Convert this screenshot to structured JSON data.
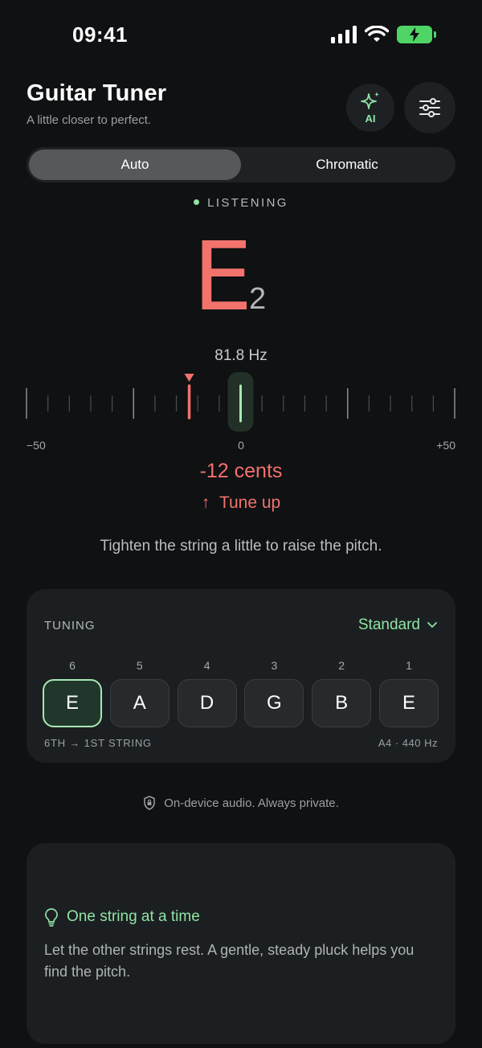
{
  "status_bar": {
    "time": "09:41"
  },
  "header": {
    "title": "Guitar Tuner",
    "subtitle": "A little closer to perfect.",
    "ai_label": "AI"
  },
  "mode_toggle": {
    "options": [
      "Auto",
      "Chromatic"
    ],
    "selected": "Auto"
  },
  "listening": "LISTENING",
  "note": {
    "letter": "E",
    "octave": "2"
  },
  "frequency": "81.8 Hz",
  "meter": {
    "min_label": "−50",
    "center_label": "0",
    "max_label": "+50",
    "cents_value": -12,
    "range": [
      -50,
      50
    ]
  },
  "cents_text": "-12 cents",
  "direction": "Tune up",
  "hint": "Tighten the string a little to raise the pitch.",
  "tuning": {
    "label": "TUNING",
    "preset": "Standard",
    "strings": [
      {
        "number": "6",
        "note": "E",
        "active": true
      },
      {
        "number": "5",
        "note": "A",
        "active": false
      },
      {
        "number": "4",
        "note": "D",
        "active": false
      },
      {
        "number": "3",
        "note": "G",
        "active": false
      },
      {
        "number": "2",
        "note": "B",
        "active": false
      },
      {
        "number": "1",
        "note": "E",
        "active": false
      }
    ],
    "footer_left": "6TH → 1ST STRING",
    "footer_right": "A4 · 440 Hz"
  },
  "privacy": "On-device audio. Always private.",
  "tip": {
    "title": "One string at a time",
    "body": "Let the other strings rest. A gentle, steady pluck helps you find the pitch."
  },
  "colors": {
    "accent_green": "#8fe3a4",
    "flat_red": "#f2726c",
    "battery_green": "#4fd566"
  }
}
